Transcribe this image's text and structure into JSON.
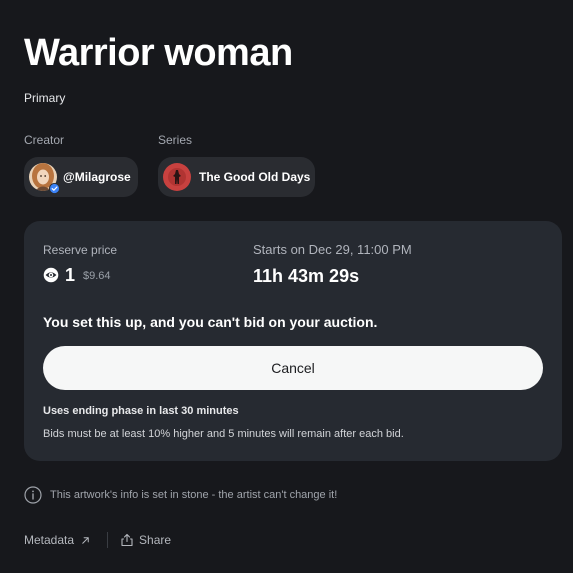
{
  "artwork": {
    "title": "Warrior woman",
    "edition": "Primary"
  },
  "creator": {
    "label": "Creator",
    "handle": "@Milagrose",
    "avatar_icon": "avatar-portrait",
    "verified_icon": "verified-badge-icon"
  },
  "series": {
    "label": "Series",
    "name": "The Good Old Days",
    "thumbnail_icon": "series-thumbnail"
  },
  "auction": {
    "reserve_label": "Reserve price",
    "currency_icon": "eye-icon",
    "price": "1",
    "price_usd": "$9.64",
    "starts_label": "Starts on Dec 29, 11:00 PM",
    "countdown": "11h 43m 29s",
    "notice": "You set this up, and you can't bid on your auction.",
    "cancel_label": "Cancel",
    "ending_title": "Uses ending phase in last 30 minutes",
    "ending_desc": "Bids must be at least 10% higher and 5 minutes will remain after each bid."
  },
  "info": {
    "icon": "info-icon",
    "text": "This artwork's info is set in stone - the artist can't change it!"
  },
  "footer": {
    "metadata_label": "Metadata",
    "share_label": "Share"
  },
  "colors": {
    "background": "#17181c",
    "card": "#262a31",
    "pill": "#2a2c31",
    "button": "#f6f7f7",
    "verified": "#3b82f6"
  }
}
